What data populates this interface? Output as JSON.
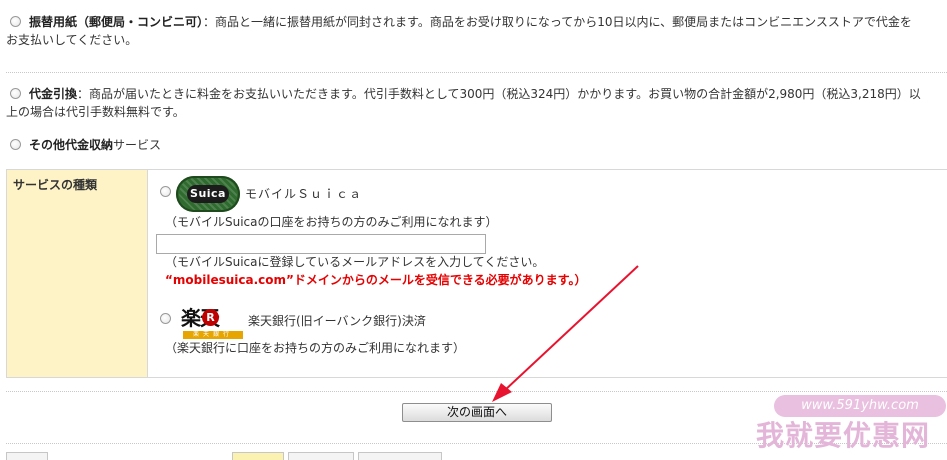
{
  "payment_options": {
    "furikae": {
      "title": "振替用紙（郵便局・コンビニ可）",
      "desc_line1": "：商品と一緒に振替用紙が同封されます。商品をお受け取りになってから10日以内に、郵便局またはコンビニエンスストアで代金を",
      "desc_line2": "お支払いしてください。"
    },
    "daibiki": {
      "title": "代金引換",
      "desc_line1": "：商品が届いたときに料金をお支払いいただきます。代引手数料として300円（税込324円）かかります。お買い物の合計金額が2,980円（税込3,218円）以",
      "desc_line2": "上の場合は代引手数料無料です。"
    },
    "other": {
      "title": "その他代金収納",
      "suffix": "サービス"
    }
  },
  "service_table": {
    "header": "サービスの種類",
    "suica": {
      "logo_text": "Suica",
      "label": "モバイルＳｕｉｃａ",
      "note": "（モバイルSuicaの口座をお持ちの方のみご利用になれます）",
      "email_value": "",
      "email_note": "（モバイルSuicaに登録しているメールアドレスを入力してください。",
      "warning": "“mobilesuica.com”ドメインからのメールを受信できる必要があります。）"
    },
    "rakuten": {
      "logo_chars": "楽天",
      "logo_circle": "R",
      "logo_bar": "楽天銀行",
      "label": "楽天銀行(旧イーバンク銀行)決済",
      "note": "（楽天銀行に口座をお持ちの方のみご利用になれます）"
    }
  },
  "next_button": "次の画面へ",
  "watermark": {
    "url": "www.591yhw.com",
    "text": "我就要优惠网"
  },
  "colors": {
    "header_bg": "#fdf3c6",
    "warning": "#e60000",
    "arrow": "#e8132f"
  }
}
